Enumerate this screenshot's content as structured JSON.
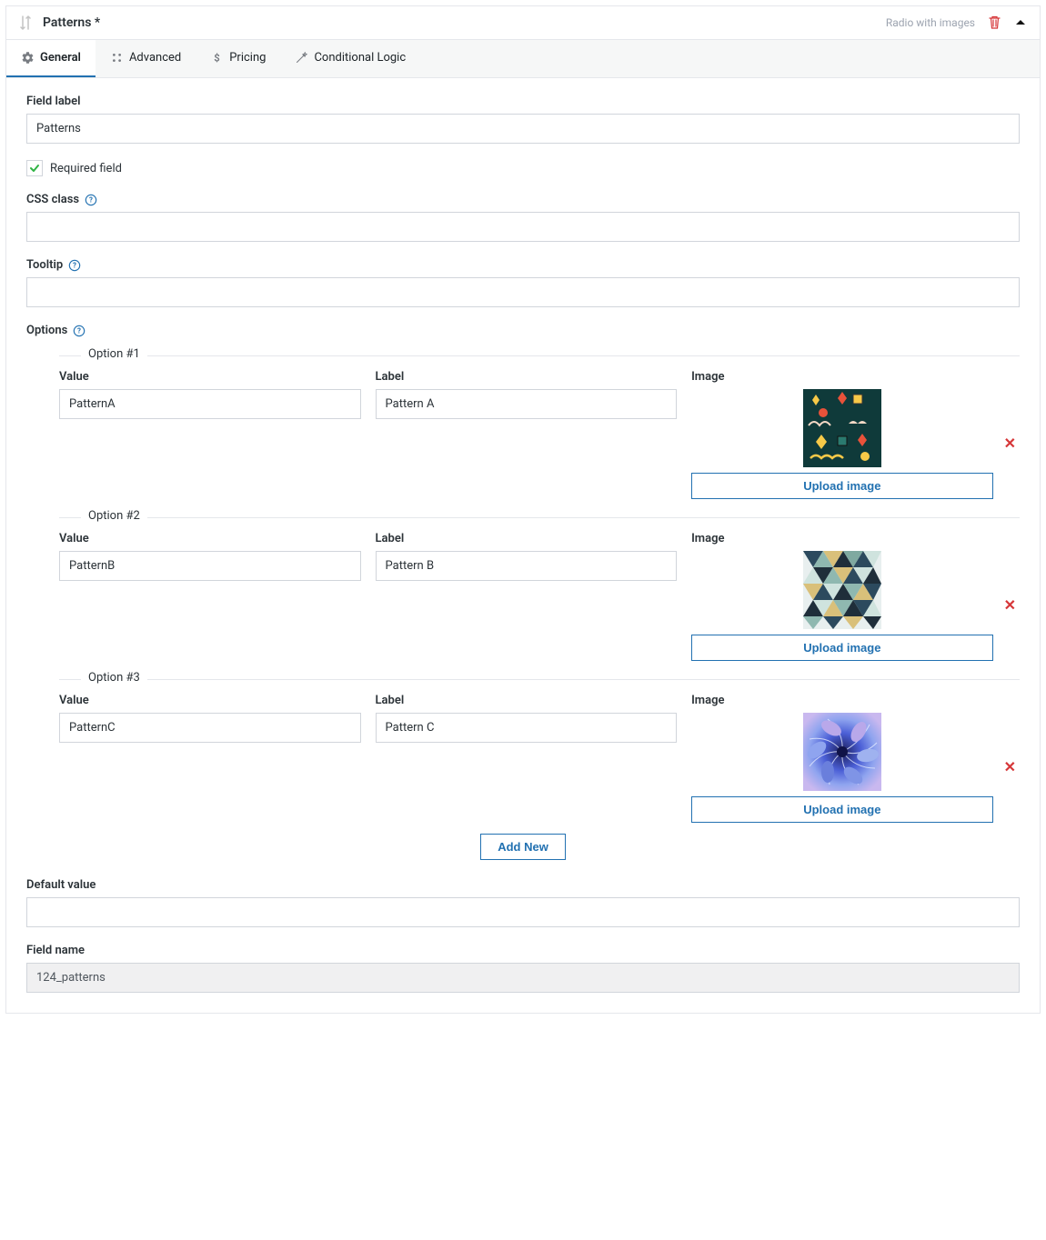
{
  "header": {
    "title": "Patterns *",
    "type_label": "Radio with images"
  },
  "tabs": [
    {
      "id": "general",
      "label": "General",
      "active": true
    },
    {
      "id": "advanced",
      "label": "Advanced",
      "active": false
    },
    {
      "id": "pricing",
      "label": "Pricing",
      "active": false
    },
    {
      "id": "logic",
      "label": "Conditional Logic",
      "active": false
    }
  ],
  "form": {
    "field_label_caption": "Field label",
    "field_label_value": "Patterns",
    "required_checked": true,
    "required_label": "Required field",
    "css_class_caption": "CSS class",
    "css_class_value": "",
    "tooltip_caption": "Tooltip",
    "tooltip_value": "",
    "options_caption": "Options",
    "value_caption": "Value",
    "label_caption": "Label",
    "image_caption": "Image",
    "upload_label": "Upload image",
    "add_new_label": "Add New",
    "default_value_caption": "Default value",
    "default_value": "",
    "field_name_caption": "Field name",
    "field_name_value": "124_patterns",
    "options": [
      {
        "legend": "Option #1",
        "value": "PatternA",
        "label": "Pattern A"
      },
      {
        "legend": "Option #2",
        "value": "PatternB",
        "label": "Pattern B"
      },
      {
        "legend": "Option #3",
        "value": "PatternC",
        "label": "Pattern C"
      }
    ]
  }
}
